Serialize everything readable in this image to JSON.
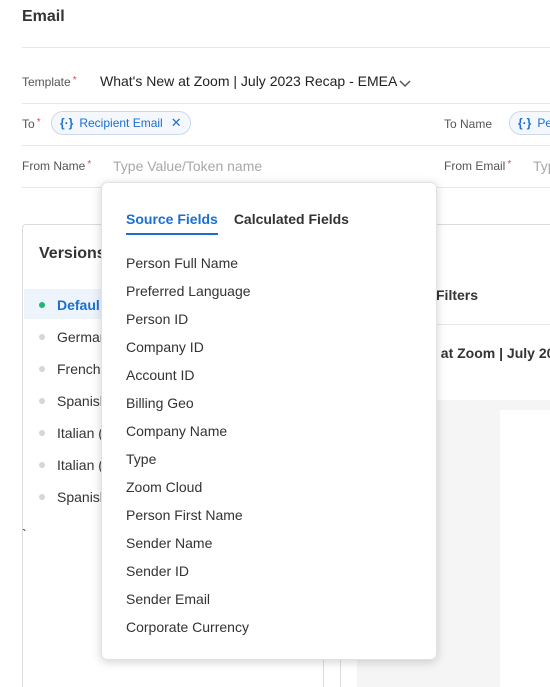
{
  "page": {
    "title": "Email"
  },
  "form": {
    "template": {
      "label": "Template",
      "value": "What's New at Zoom | July 2023 Recap - EMEA"
    },
    "to": {
      "label": "To",
      "chip_label": "Recipient Email",
      "token_glyph": "{·}"
    },
    "to_name": {
      "label": "To Name",
      "chip_label": "Per"
    },
    "from_name": {
      "label": "From Name",
      "placeholder": "Type Value/Token name"
    },
    "from_email": {
      "label": "From Email",
      "placeholder": "Typ"
    },
    "required_marker": "*"
  },
  "versions": {
    "title": "Versions",
    "items": [
      {
        "label": "Defaul",
        "active": true
      },
      {
        "label": "Germar"
      },
      {
        "label": "French"
      },
      {
        "label": "Spanish"
      },
      {
        "label": "Italian ("
      },
      {
        "label": "Italian ("
      },
      {
        "label": "Spanish"
      }
    ],
    "stray_mark": "`"
  },
  "preview": {
    "filters_label": "Filters",
    "subject_fragment": "w at Zoom | July 20"
  },
  "token_dropdown": {
    "tabs": [
      "Source Fields",
      "Calculated Fields"
    ],
    "active_tab": "Source Fields",
    "items": [
      "Person Full Name",
      "Preferred Language",
      "Person ID",
      "Company ID",
      "Account ID",
      "Billing Geo",
      "Company Name",
      "Type",
      "Zoom Cloud",
      "Person First Name",
      "Sender Name",
      "Sender ID",
      "Sender Email",
      "Corporate Currency"
    ]
  },
  "colors": {
    "accent": "#1a6fd1",
    "required": "#e5484d",
    "active_dot": "#22b573"
  },
  "icons": {
    "chevron": "chevron-down-icon",
    "remove": "close-icon"
  }
}
